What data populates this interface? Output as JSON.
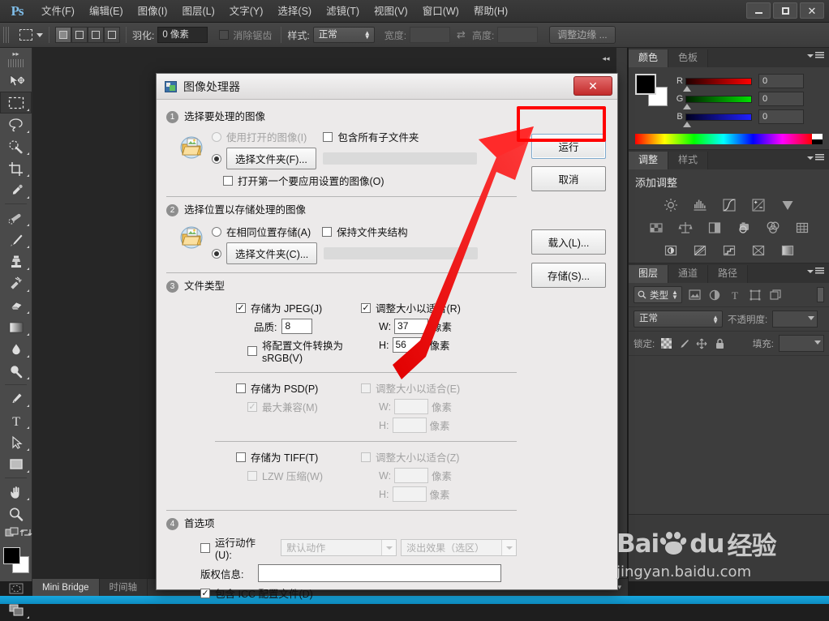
{
  "app": {
    "logo": "Ps",
    "menus": [
      "文件(F)",
      "编辑(E)",
      "图像(I)",
      "图层(L)",
      "文字(Y)",
      "选择(S)",
      "滤镜(T)",
      "视图(V)",
      "窗口(W)",
      "帮助(H)"
    ],
    "window_controls": {
      "minimize": "—",
      "maximize": "▢",
      "close": "✕"
    }
  },
  "options_bar": {
    "feather_label": "羽化:",
    "feather_value": "0 像素",
    "antialias_label": "消除锯齿",
    "style_label": "样式:",
    "style_value": "正常",
    "width_label": "宽度:",
    "width_value": "",
    "height_label": "高度:",
    "height_value": "",
    "refine_edge_label": "调整边缘 ..."
  },
  "toolbar": {
    "tools": [
      "move-tool",
      "rectangular-marquee-tool",
      "lasso-tool",
      "quick-selection-tool",
      "crop-tool",
      "eyedropper-tool",
      "healing-brush-tool",
      "brush-tool",
      "clone-stamp-tool",
      "history-brush-tool",
      "eraser-tool",
      "gradient-tool",
      "blur-tool",
      "dodge-tool",
      "pen-tool",
      "type-tool",
      "path-selection-tool",
      "rectangle-tool",
      "hand-tool",
      "zoom-tool"
    ],
    "foreground_color": "#000000",
    "background_color": "#ffffff"
  },
  "dialog": {
    "title": "图像处理器",
    "close_label": "✕",
    "sections": [
      {
        "number": "1",
        "title": "选择要处理的图像",
        "use_open_images": "使用打开的图像(I)",
        "include_subfolders": "包含所有子文件夹",
        "select_folder_btn": "选择文件夹(F)...",
        "open_first_image": "打开第一个要应用设置的图像(O)"
      },
      {
        "number": "2",
        "title": "选择位置以存储处理的图像",
        "save_same_location": "在相同位置存储(A)",
        "keep_folder_structure": "保持文件夹结构",
        "select_folder_btn": "选择文件夹(C)..."
      },
      {
        "number": "3",
        "title": "文件类型",
        "jpeg": {
          "save_label": "存储为 JPEG(J)",
          "quality_label": "品质:",
          "quality_value": "8",
          "srgb_label": "将配置文件转换为 sRGB(V)",
          "resize_label": "调整大小以适合(R)",
          "w_label": "W:",
          "w_value": "37",
          "h_label": "H:",
          "h_value": "56",
          "unit": "像素"
        },
        "psd": {
          "save_label": "存储为 PSD(P)",
          "max_compat_label": "最大兼容(M)",
          "resize_label": "调整大小以适合(E)",
          "w_label": "W:",
          "w_value": "",
          "h_label": "H:",
          "h_value": "",
          "unit": "像素"
        },
        "tiff": {
          "save_label": "存储为 TIFF(T)",
          "lzw_label": "LZW 压缩(W)",
          "resize_label": "调整大小以适合(Z)",
          "w_label": "W:",
          "w_value": "",
          "h_label": "H:",
          "h_value": "",
          "unit": "像素"
        }
      },
      {
        "number": "4",
        "title": "首选项",
        "run_action_label": "运行动作(U):",
        "action_set_value": "默认动作",
        "action_value": "淡出效果（选区）",
        "copyright_label": "版权信息:",
        "copyright_value": "",
        "include_icc_label": "包含 ICC 配置文件(D)"
      }
    ],
    "buttons": {
      "run": "运行",
      "cancel": "取消",
      "load": "载入(L)...",
      "save": "存储(S)..."
    },
    "highlight_color": "#ff0000"
  },
  "panels": {
    "color": {
      "tabs": [
        "颜色",
        "色板"
      ],
      "active_tab": "颜色",
      "channels": [
        {
          "label": "R",
          "value": "0"
        },
        {
          "label": "G",
          "value": "0"
        },
        {
          "label": "B",
          "value": "0"
        }
      ]
    },
    "adjustments": {
      "tabs": [
        "调整",
        "样式"
      ],
      "active_tab": "调整",
      "heading": "添加调整",
      "icons": [
        "brightness-contrast-icon",
        "levels-icon",
        "curves-icon",
        "exposure-icon",
        "vibrance-icon",
        "hue-saturation-icon",
        "color-balance-icon",
        "black-white-icon",
        "photo-filter-icon",
        "channel-mixer-icon",
        "color-lookup-icon",
        "invert-icon",
        "posterize-icon",
        "threshold-icon",
        "selective-color-icon",
        "gradient-map-icon"
      ]
    },
    "layers": {
      "tabs": [
        "图层",
        "通道",
        "路径"
      ],
      "active_tab": "图层",
      "filter_label": "类型",
      "blend_mode": "正常",
      "opacity_label": "不透明度:",
      "opacity_value": "",
      "lock_label": "锁定:",
      "fill_label": "填充:",
      "fill_value": "",
      "filter_icons": [
        "image-filter-icon",
        "adjustment-filter-icon",
        "type-filter-icon",
        "shape-filter-icon",
        "smart-object-filter-icon"
      ],
      "lock_icons": [
        "lock-transparency-icon",
        "lock-pixels-icon",
        "lock-position-icon",
        "lock-all-icon"
      ]
    }
  },
  "bottom_bar": {
    "tabs": [
      "Mini Bridge",
      "时间轴"
    ],
    "active_tab": "Mini Bridge"
  },
  "watermark": {
    "brand": "Bai",
    "brand2": "du",
    "suffix": "经验",
    "url": "jingyan.baidu.com"
  }
}
